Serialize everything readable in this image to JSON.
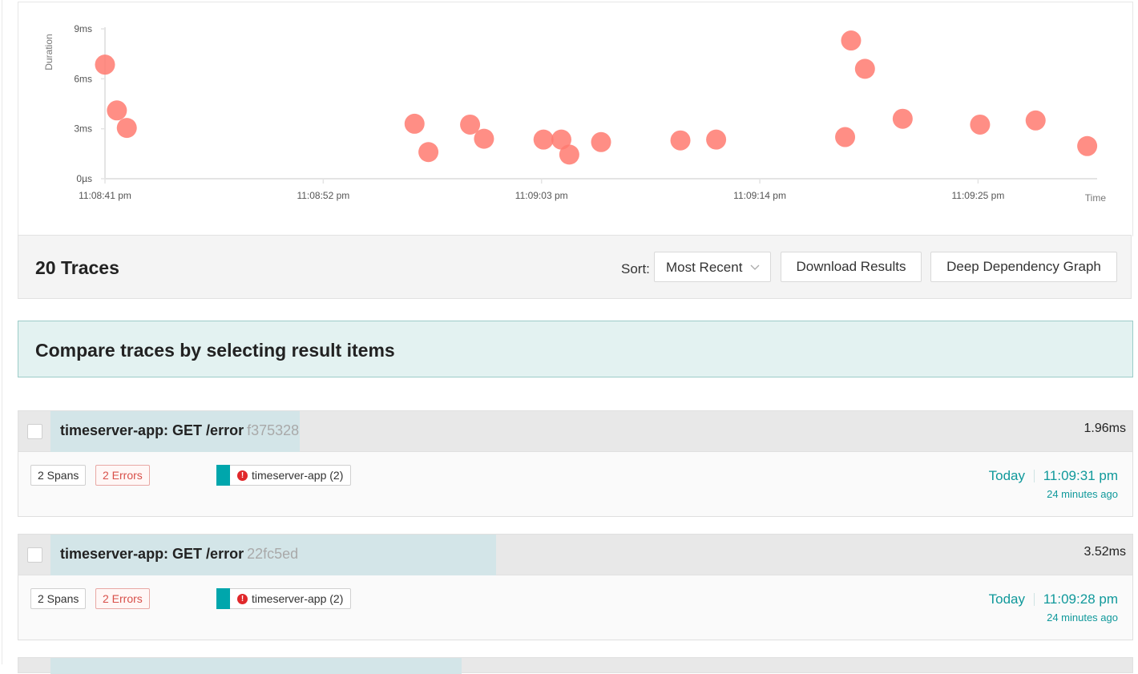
{
  "chart_data": {
    "type": "scatter",
    "ylabel": "Duration",
    "xlabel": "Time",
    "y_ticks": [
      "0µs",
      "3ms",
      "6ms",
      "9ms"
    ],
    "y_tick_values_ms": [
      0,
      3,
      6,
      9
    ],
    "x_ticks": [
      "11:08:41 pm",
      "11:08:52 pm",
      "11:09:03 pm",
      "11:09:14 pm",
      "11:09:25 pm"
    ],
    "x_tick_values_s": [
      41,
      52,
      63,
      74,
      85
    ],
    "x_unit": "seconds after 11:08:00 pm",
    "y_unit": "ms",
    "ylim": [
      0,
      9
    ],
    "xlim": [
      41,
      91
    ],
    "point_color": "#ff7a70",
    "points": [
      {
        "x": 41.0,
        "y": 6.85
      },
      {
        "x": 41.6,
        "y": 4.1
      },
      {
        "x": 42.1,
        "y": 3.05
      },
      {
        "x": 56.6,
        "y": 3.3
      },
      {
        "x": 57.3,
        "y": 1.6
      },
      {
        "x": 59.4,
        "y": 3.25
      },
      {
        "x": 60.1,
        "y": 2.4
      },
      {
        "x": 63.1,
        "y": 2.35
      },
      {
        "x": 64.0,
        "y": 2.35
      },
      {
        "x": 64.4,
        "y": 1.45
      },
      {
        "x": 66.0,
        "y": 2.2
      },
      {
        "x": 70.0,
        "y": 2.3
      },
      {
        "x": 71.8,
        "y": 2.35
      },
      {
        "x": 78.3,
        "y": 2.5
      },
      {
        "x": 78.6,
        "y": 8.3
      },
      {
        "x": 79.3,
        "y": 6.6
      },
      {
        "x": 81.2,
        "y": 3.6
      },
      {
        "x": 85.1,
        "y": 3.25
      },
      {
        "x": 87.9,
        "y": 3.5
      },
      {
        "x": 90.5,
        "y": 1.96
      }
    ]
  },
  "results": {
    "count_label": "20 Traces",
    "sort_label": "Sort:",
    "sort_value": "Most Recent",
    "download_label": "Download Results",
    "ddg_label": "Deep Dependency Graph"
  },
  "compare_banner": "Compare traces by selecting result items",
  "traces": [
    {
      "title": "timeserver-app: GET /error",
      "trace_id": "f375328",
      "duration": "1.96ms",
      "duration_fraction": 0.23,
      "spans": "2 Spans",
      "errors": "2 Errors",
      "service": "timeserver-app (2)",
      "service_color": "#00a6ac",
      "day": "Today",
      "time": "11:09:31 pm",
      "ago": "24 minutes ago"
    },
    {
      "title": "timeserver-app: GET /error",
      "trace_id": "22fc5ed",
      "duration": "3.52ms",
      "duration_fraction": 0.412,
      "spans": "2 Spans",
      "errors": "2 Errors",
      "service": "timeserver-app (2)",
      "service_color": "#00a6ac",
      "day": "Today",
      "time": "11:09:28 pm",
      "ago": "24 minutes ago"
    }
  ],
  "partial_next_trace": {
    "duration_fraction": 0.38
  },
  "icons": {
    "error": "exclamation-circle-icon",
    "sort": "chevron-down-icon"
  }
}
